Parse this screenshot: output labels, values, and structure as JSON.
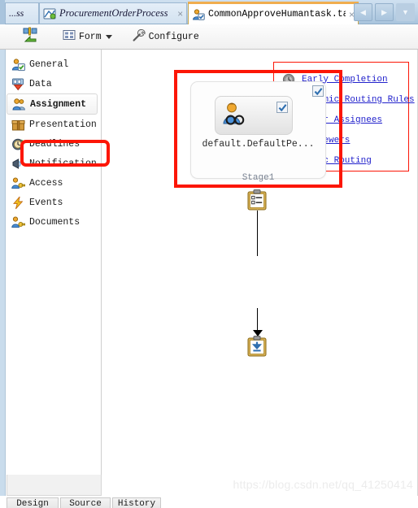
{
  "window": {
    "tabs": [
      {
        "label": "...ss",
        "icon": "none",
        "close": "",
        "state": "clipped"
      },
      {
        "label": "ProcurementOrderProcess",
        "icon": "process-icon",
        "close": "×",
        "state": "inactive"
      },
      {
        "label": "CommonApproveHumantask.task",
        "icon": "humantask-icon",
        "close": "×",
        "state": "active"
      }
    ],
    "nav_buttons": [
      {
        "name": "tab-scroll-left",
        "glyph": "◀"
      },
      {
        "name": "tab-scroll-right",
        "glyph": "▶"
      },
      {
        "name": "tab-list-dropdown",
        "glyph": "▼"
      }
    ]
  },
  "toolbar": {
    "items": [
      {
        "label": "",
        "icon": "routing-icon",
        "has_caret": false
      },
      {
        "label": "Form",
        "icon": "form-icon",
        "has_caret": true
      },
      {
        "label": "Configure",
        "icon": "wrench-icon",
        "has_caret": false
      }
    ]
  },
  "sidebar": {
    "items": [
      {
        "label": "General",
        "icon": "general-icon",
        "selected": false
      },
      {
        "label": "Data",
        "icon": "data-icon",
        "selected": false
      },
      {
        "label": "Assignment",
        "icon": "assignment-icon",
        "selected": true
      },
      {
        "label": "Presentation",
        "icon": "presentation-icon",
        "selected": false
      },
      {
        "label": "Deadlines",
        "icon": "deadlines-icon",
        "selected": false
      },
      {
        "label": "Notification",
        "icon": "notification-icon",
        "selected": false
      },
      {
        "label": "Access",
        "icon": "access-icon",
        "selected": false
      },
      {
        "label": "Events",
        "icon": "events-icon",
        "selected": false
      },
      {
        "label": "Documents",
        "icon": "documents-icon",
        "selected": false
      }
    ]
  },
  "link_panel": {
    "links": [
      {
        "label": "Early Completion",
        "icon": "clock-icon"
      },
      {
        "label": "Dynamic Routing Rules",
        "icon": "diamond-icon"
      },
      {
        "label": "Error Assignees",
        "icon": "group-error-icon"
      },
      {
        "label": "Reviewers",
        "icon": "group-review-icon"
      },
      {
        "label": "Adhoc Routing",
        "icon": "group-adhoc-icon"
      }
    ]
  },
  "diagram": {
    "start_node": {
      "name": "start-clipboard-node",
      "icon": "clipboard-icon"
    },
    "end_node": {
      "name": "end-clipboard-node",
      "icon": "clipboard-download-icon"
    },
    "stage": {
      "label": "Stage1",
      "checkbox_checked": true,
      "task": {
        "label": "default.DefaultPe...",
        "icon": "participant-reviewer-icon",
        "checkbox_checked": true
      }
    }
  },
  "bottom_tabs": [
    {
      "label": "Design"
    },
    {
      "label": "Source"
    },
    {
      "label": "History"
    }
  ],
  "watermark": {
    "text": "https://blog.csdn.net/qq_41250414"
  },
  "colors": {
    "accent_red": "#fc1606",
    "link_blue": "#2222cc",
    "tab_active_top": "#f0ad4e",
    "titlebar_blue": "#a9c4dd"
  }
}
